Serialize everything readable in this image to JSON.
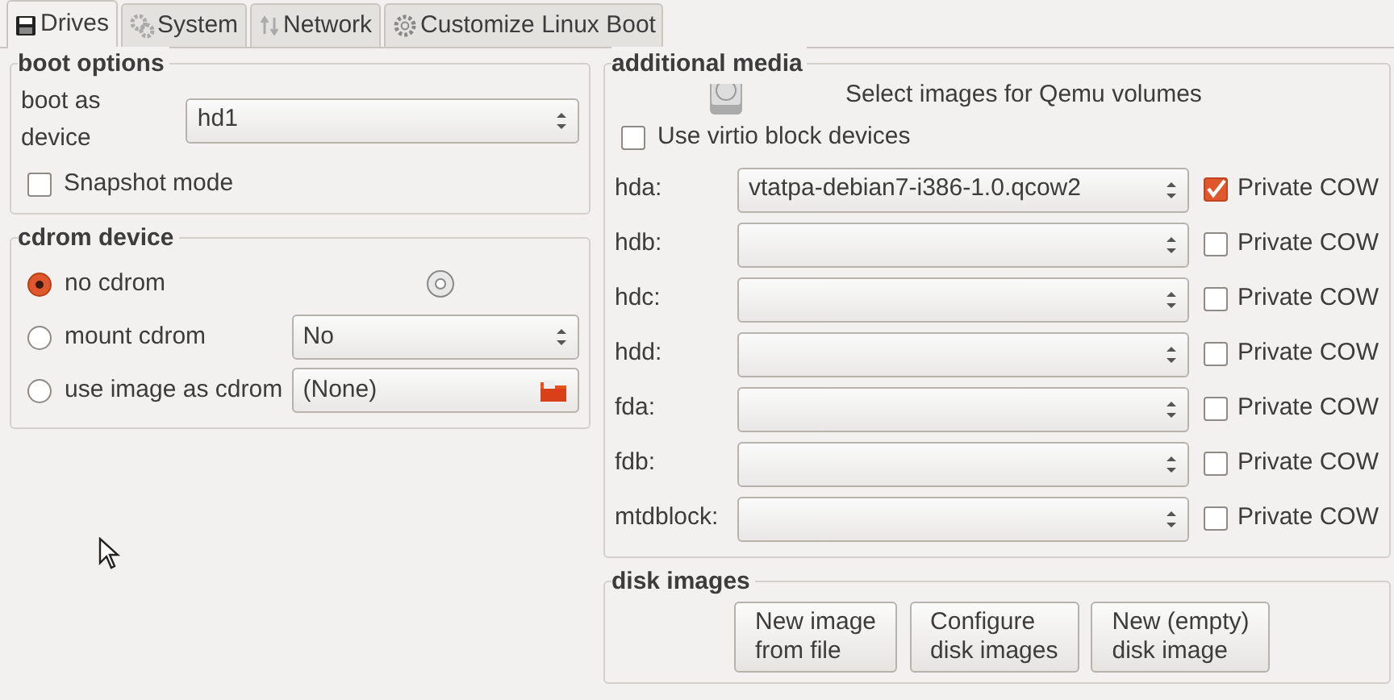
{
  "tabs": [
    {
      "label": "Drives",
      "selected": true
    },
    {
      "label": "System",
      "selected": false
    },
    {
      "label": "Network",
      "selected": false
    },
    {
      "label": "Customize Linux Boot",
      "selected": false
    }
  ],
  "boot_options": {
    "title": "boot options",
    "boot_device_label": "boot as device",
    "boot_device": "hd1",
    "snapshot": {
      "label": "Snapshot mode",
      "checked": false
    }
  },
  "cdrom_device": {
    "title": "cdrom device",
    "options": [
      {
        "kind": "none",
        "label": "no cdrom",
        "selected": true
      },
      {
        "kind": "mount",
        "label": "mount cdrom",
        "selected": false,
        "value": "No"
      },
      {
        "kind": "image",
        "label": "use image as cdrom",
        "selected": false,
        "value": "(None)"
      }
    ]
  },
  "additional_media": {
    "title": "additional media",
    "caption": "Select images for Qemu volumes",
    "virtio": {
      "label": "Use virtio block devices",
      "checked": false
    },
    "drives": [
      {
        "label": "hda:",
        "value": "vtatpa-debian7-i386-1.0.qcow2",
        "cow_label": "Private COW",
        "private_cow": true
      },
      {
        "label": "hdb:",
        "cow_label": "Private COW",
        "private_cow": false
      },
      {
        "label": "hdc:",
        "cow_label": "Private COW",
        "private_cow": false
      },
      {
        "label": "hdd:",
        "cow_label": "Private COW",
        "private_cow": false
      },
      {
        "label": "fda:",
        "cow_label": "Private COW",
        "private_cow": false
      },
      {
        "label": "fdb:",
        "cow_label": "Private COW",
        "private_cow": false
      },
      {
        "label": "mtdblock:",
        "cow_label": "Private COW",
        "private_cow": false
      }
    ]
  },
  "disk_images": {
    "title": "disk images",
    "buttons": [
      "New image\nfrom file",
      "Configure\ndisk images",
      "New (empty)\ndisk image"
    ]
  }
}
